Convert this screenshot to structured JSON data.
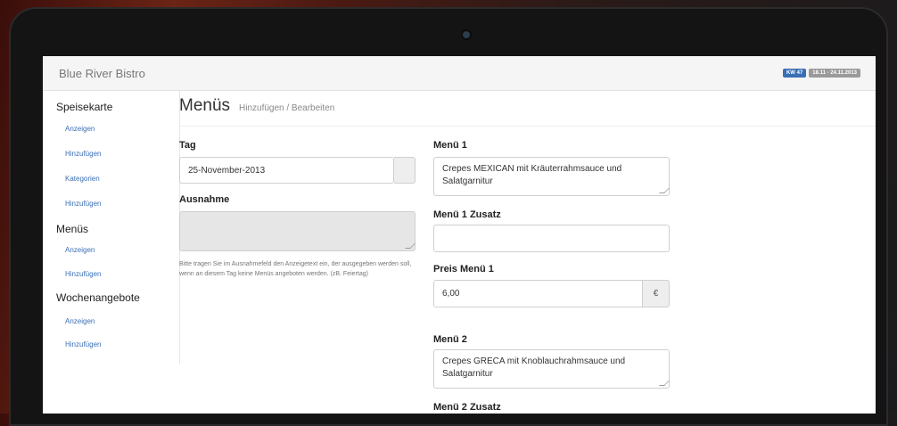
{
  "brand": "Blue River Bistro",
  "badges": {
    "week": "KW 47",
    "range": "18.11 - 24.11.2013"
  },
  "sidebar": {
    "sections": [
      {
        "title": "Speisekarte",
        "links": [
          "Anzeigen",
          "Hinzufügen",
          "Kategorien",
          "Hinzufügen"
        ]
      },
      {
        "title": "Menüs",
        "links": [
          "Anzeigen",
          "Hinzufügen"
        ]
      },
      {
        "title": "Wochenangebote",
        "links": [
          "Anzeigen",
          "Hinzufügen"
        ]
      }
    ]
  },
  "header": {
    "title": "Menüs",
    "subtitle": "Hinzufügen / Bearbeiten"
  },
  "form": {
    "tag": {
      "label": "Tag",
      "value": "25-November-2013"
    },
    "ausnahme": {
      "label": "Ausnahme",
      "value": "",
      "help": "Bitte tragen Sie im Ausnahmefeld den Anzeigetext ein, der ausgegeben werden soll, wenn an diesem Tag keine Menüs angeboten werden. (zB. Feiertag)"
    },
    "menu1": {
      "label": "Menü 1",
      "value": "Crepes MEXICAN mit Kräuterrahmsauce und Salatgarnitur"
    },
    "menu1_zusatz": {
      "label": "Menü 1 Zusatz",
      "value": ""
    },
    "preis1": {
      "label": "Preis Menü 1",
      "value": "6,00",
      "currency": "€"
    },
    "menu2": {
      "label": "Menü 2",
      "value": "Crepes GRECA mit Knoblauchrahmsauce und Salatgarnitur"
    },
    "menu2_zusatz": {
      "label": "Menü 2 Zusatz"
    }
  }
}
